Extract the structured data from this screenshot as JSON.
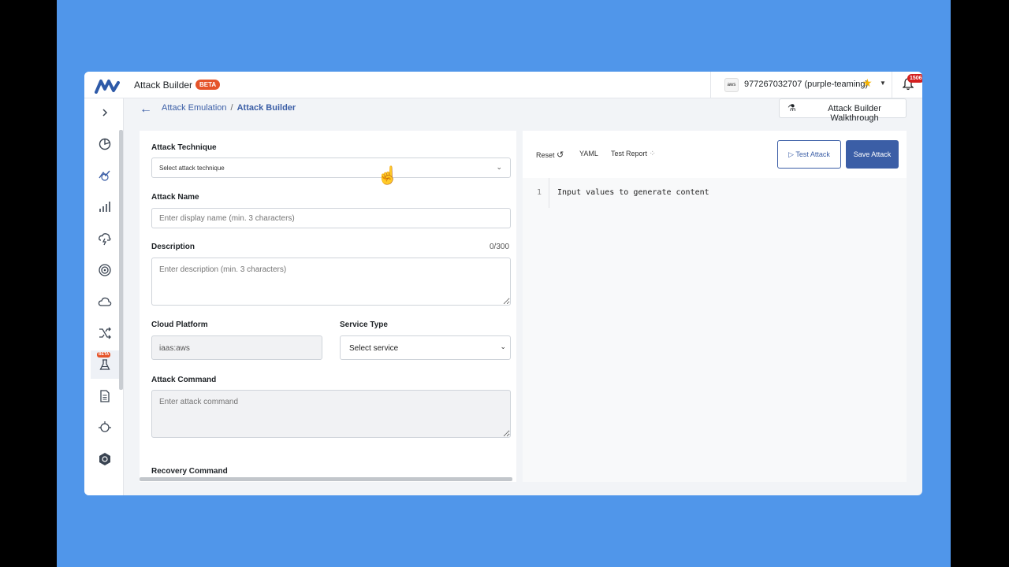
{
  "app": {
    "title": "Attack Builder",
    "beta_label": "BETA"
  },
  "account": {
    "provider_icon": "aws",
    "label": "977267032707 (purple-teaming)"
  },
  "notifications": {
    "count": "1506"
  },
  "breadcrumb": {
    "parent": "Attack Emulation",
    "separator": "/",
    "current": "Attack Builder"
  },
  "walkthrough_button": "Attack Builder Walkthrough",
  "sidebar": {
    "beta_label": "BETA"
  },
  "form": {
    "technique": {
      "label": "Attack Technique",
      "placeholder": "Select attack technique"
    },
    "name": {
      "label": "Attack Name",
      "placeholder": "Enter display name (min. 3 characters)"
    },
    "description": {
      "label": "Description",
      "counter": "0/300",
      "placeholder": "Enter description (min. 3 characters)"
    },
    "cloud_platform": {
      "label": "Cloud Platform",
      "value": "iaas:aws"
    },
    "service_type": {
      "label": "Service Type",
      "placeholder": "Select service"
    },
    "attack_command": {
      "label": "Attack Command",
      "placeholder": "Enter attack command"
    },
    "recovery_command": {
      "label": "Recovery Command"
    }
  },
  "editor": {
    "reset_label": "Reset",
    "yaml_label": "YAML",
    "test_report_label": "Test Report",
    "test_attack_label": "Test Attack",
    "save_attack_label": "Save Attack",
    "line_number": "1",
    "content": "Input values to generate content"
  },
  "colors": {
    "accent": "#3b5ea6",
    "beta": "#e5542a",
    "background": "#5096ea"
  }
}
